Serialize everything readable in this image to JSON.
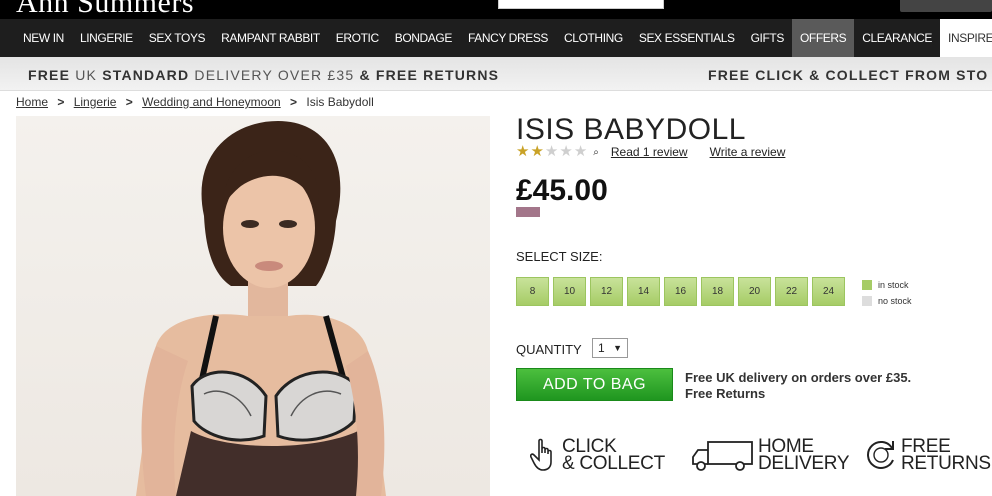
{
  "header": {
    "logo": "Ann Summers"
  },
  "nav": {
    "items": [
      {
        "label": "NEW IN",
        "style": "normal"
      },
      {
        "label": "LINGERIE",
        "style": "normal"
      },
      {
        "label": "SEX TOYS",
        "style": "normal"
      },
      {
        "label": "RAMPANT RABBIT",
        "style": "normal"
      },
      {
        "label": "EROTIC",
        "style": "normal"
      },
      {
        "label": "BONDAGE",
        "style": "normal"
      },
      {
        "label": "FANCY DRESS",
        "style": "normal"
      },
      {
        "label": "CLOTHING",
        "style": "normal"
      },
      {
        "label": "SEX ESSENTIALS",
        "style": "normal"
      },
      {
        "label": "GIFTS",
        "style": "normal"
      },
      {
        "label": "OFFERS",
        "style": "grey"
      },
      {
        "label": "CLEARANCE",
        "style": "normal"
      },
      {
        "label": "INSPIRE",
        "style": "white"
      }
    ]
  },
  "promo": {
    "free1": "FREE",
    "uk": "UK",
    "standard": "STANDARD",
    "delivery_over": "DELIVERY OVER £35",
    "and_free_returns": "& FREE RETURNS",
    "right": "FREE CLICK & COLLECT FROM STO"
  },
  "breadcrumb": {
    "home": "Home",
    "lingerie": "Lingerie",
    "category": "Wedding and Honeymoon",
    "current": "Isis Babydoll",
    "separator": ">"
  },
  "product": {
    "title": "ISIS BABYDOLL",
    "rating": 2,
    "rating_max": 5,
    "read_review": "Read 1 review",
    "write_review": "Write a review",
    "price": "£45.00",
    "swatch_color": "#a3768a"
  },
  "sizes": {
    "label": "SELECT SIZE:",
    "options": [
      "8",
      "10",
      "12",
      "14",
      "16",
      "18",
      "20",
      "22",
      "24"
    ],
    "legend_in": "in stock",
    "legend_no": "no stock"
  },
  "quantity": {
    "label": "QUANTITY",
    "value": "1"
  },
  "cart": {
    "add_label": "ADD TO BAG",
    "note_line1": "Free UK delivery on orders over £35.",
    "note_line2": "Free Returns"
  },
  "services": {
    "click_1": "CLICK",
    "click_2": "& COLLECT",
    "home_1": "HOME",
    "home_2": "DELIVERY",
    "free_1": "FREE",
    "free_2": "RETURNS"
  },
  "colors": {
    "nav_bg": "#1e1e1e",
    "size_green": "#a6cc66",
    "add_green": "#1f9620",
    "star_gold": "#c9a227"
  }
}
